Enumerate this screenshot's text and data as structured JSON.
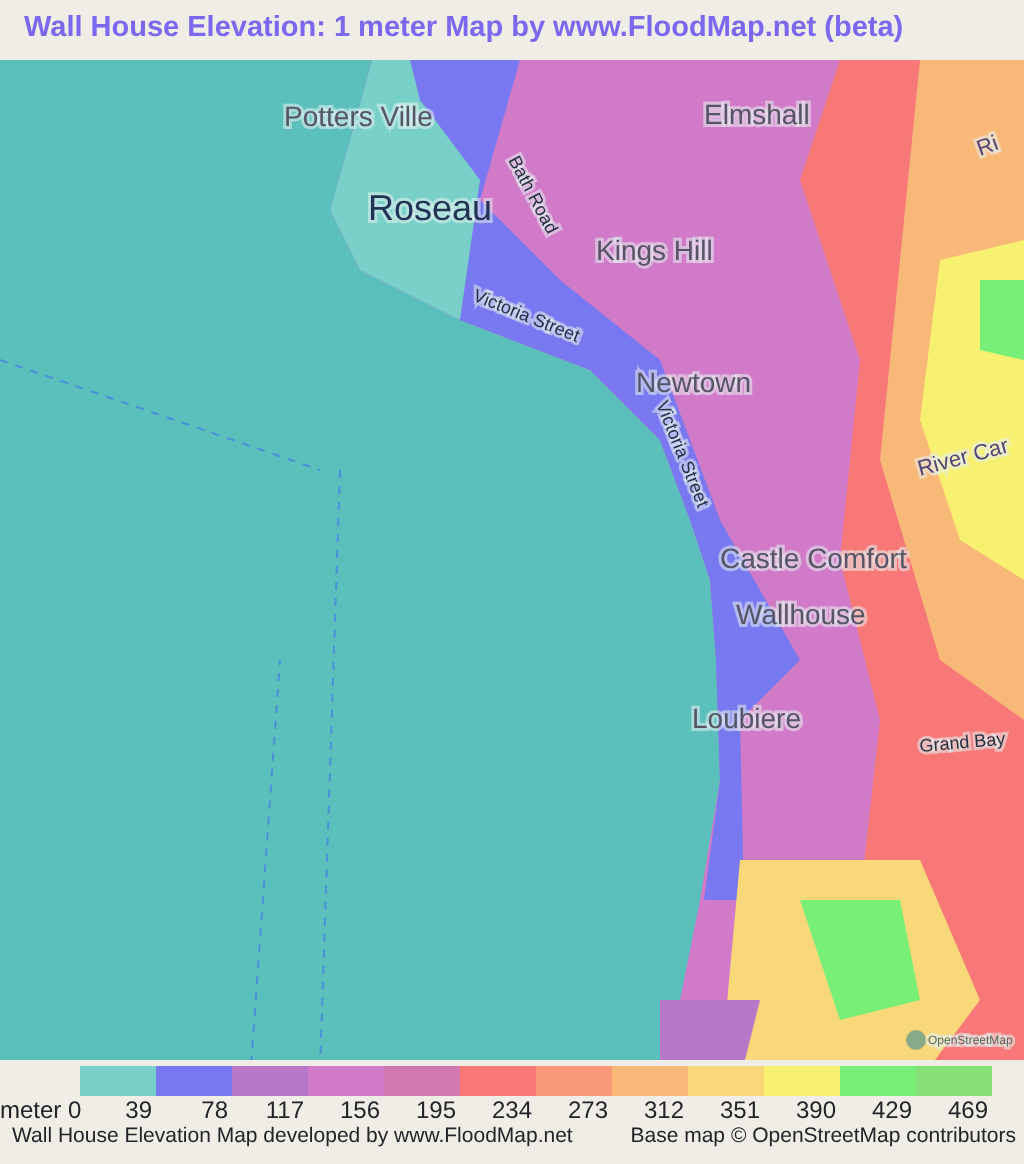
{
  "title": "Wall House Elevation: 1 meter Map by www.FloodMap.net (beta)",
  "map_labels": [
    {
      "text": "Potters Ville",
      "kind": "place"
    },
    {
      "text": "Elmshall",
      "kind": "place"
    },
    {
      "text": "Roseau",
      "kind": "town"
    },
    {
      "text": "Bath Road",
      "kind": "street"
    },
    {
      "text": "Kings Hill",
      "kind": "place"
    },
    {
      "text": "Ri",
      "kind": "river"
    },
    {
      "text": "Victoria Street",
      "kind": "street"
    },
    {
      "text": "Newtown",
      "kind": "place"
    },
    {
      "text": "Victoria Street",
      "kind": "street"
    },
    {
      "text": "River Car",
      "kind": "river"
    },
    {
      "text": "Castle Comfort",
      "kind": "place"
    },
    {
      "text": "Wallhouse",
      "kind": "place"
    },
    {
      "text": "Grand Bay",
      "kind": "street"
    },
    {
      "text": "Loubiere",
      "kind": "place"
    }
  ],
  "osm_badge": "OpenStreetMap",
  "legend": {
    "start": "meter 0",
    "items": [
      {
        "color": "#78d0c8",
        "label": "39"
      },
      {
        "color": "#7878f0",
        "label": "78"
      },
      {
        "color": "#b878c8",
        "label": "117"
      },
      {
        "color": "#d07ac8",
        "label": "156"
      },
      {
        "color": "#d078b0",
        "label": "195"
      },
      {
        "color": "#f87878",
        "label": "234"
      },
      {
        "color": "#f89878",
        "label": "273"
      },
      {
        "color": "#f8b878",
        "label": "312"
      },
      {
        "color": "#f8d878",
        "label": "351"
      },
      {
        "color": "#f8f070",
        "label": "390"
      },
      {
        "color": "#78f078",
        "label": "429"
      },
      {
        "color": "#88e078",
        "label": "469"
      }
    ]
  },
  "footer": {
    "left": "Wall House Elevation Map developed by www.FloodMap.net",
    "right": "Base map © OpenStreetMap contributors"
  }
}
